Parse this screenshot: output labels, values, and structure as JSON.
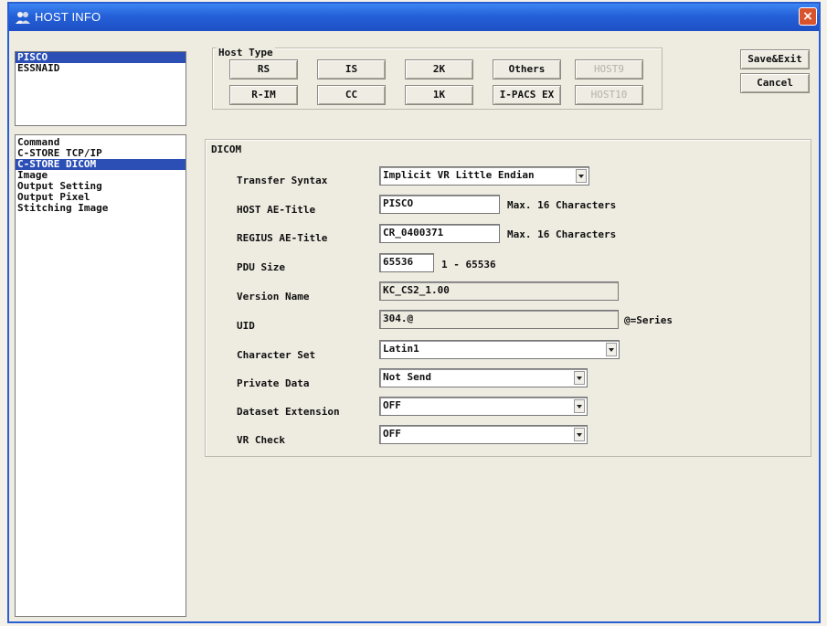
{
  "window": {
    "title": "HOST INFO",
    "close_glyph": "×"
  },
  "hosts": {
    "items": [
      "PISCO",
      "ESSNAID"
    ],
    "selected": 0
  },
  "menu": {
    "items": [
      "Command",
      "C-STORE TCP/IP",
      "C-STORE DICOM",
      "Image",
      "Output Setting",
      "Output Pixel",
      "Stitching Image"
    ],
    "selected": 2
  },
  "host_type": {
    "label": "Host Type",
    "buttons": [
      "RS",
      "IS",
      "2K",
      "Others",
      "HOST9",
      "R-IM",
      "CC",
      "1K",
      "I-PACS EX",
      "HOST10"
    ]
  },
  "actions": {
    "save_exit": "Save&Exit",
    "cancel": "Cancel"
  },
  "dicom": {
    "label": "DICOM",
    "transfer_syntax": {
      "label": "Transfer Syntax",
      "value": "Implicit VR Little Endian"
    },
    "host_ae": {
      "label": "HOST AE-Title",
      "value": "PISCO",
      "hint": "Max. 16 Characters"
    },
    "regius_ae": {
      "label": "REGIUS AE-Title",
      "value": "CR_0400371",
      "hint": "Max. 16 Characters"
    },
    "pdu": {
      "label": "PDU Size",
      "value": "65536",
      "hint": "1 - 65536"
    },
    "version": {
      "label": "Version Name",
      "value": "KC_CS2_1.00"
    },
    "uid": {
      "label": "UID",
      "value": "304.@",
      "hint": "@=Series"
    },
    "charset": {
      "label": "Character Set",
      "value": "Latin1"
    },
    "private": {
      "label": "Private Data",
      "value": "Not Send"
    },
    "dataset_ext": {
      "label": "Dataset Extension",
      "value": "OFF"
    },
    "vr_check": {
      "label": "VR Check",
      "value": "OFF"
    }
  },
  "colors": {
    "titlebar": "#2460d8",
    "selection": "#2b4fb5",
    "close": "#d9532c"
  },
  "icons": {
    "app": "host-people-icon",
    "close": "close-icon",
    "dropdown": "chevron-down-icon"
  }
}
